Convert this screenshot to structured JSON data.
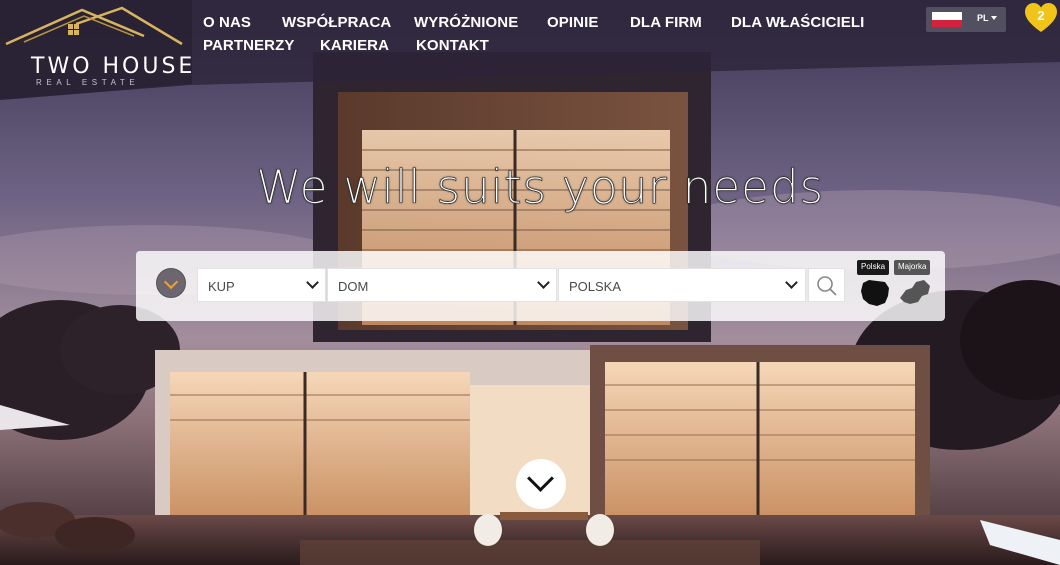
{
  "brand": {
    "name": "TWO HOUSE",
    "tagline": "REAL ESTATE"
  },
  "nav": {
    "items": [
      {
        "label": "O NAS"
      },
      {
        "label": "WSPÓŁPRACA"
      },
      {
        "label": "WYRÓŻNIONE"
      },
      {
        "label": "OPINIE"
      },
      {
        "label": "DLA FIRM"
      },
      {
        "label": "DLA WŁAŚCICIELI"
      },
      {
        "label": "PARTNERZY"
      },
      {
        "label": "KARIERA"
      },
      {
        "label": "KONTAKT"
      }
    ]
  },
  "language": {
    "selected": "PL",
    "flag": "poland-flag-icon"
  },
  "favorites": {
    "count": "2",
    "icon": "heart-icon",
    "color": "#f0c419"
  },
  "hero": {
    "headline": "We will suits your needs"
  },
  "search": {
    "toggle_icon": "chevron-down-icon",
    "toggle_color": "#f3a12a",
    "transaction": {
      "selected": "KUP"
    },
    "property_type": {
      "selected": "DOM"
    },
    "location": {
      "selected": "POLSKA"
    },
    "submit_icon": "search-icon",
    "regions": [
      {
        "label": "Polska",
        "icon": "poland-map-icon"
      },
      {
        "label": "Majorka",
        "icon": "majorca-map-icon"
      }
    ]
  },
  "scroll_icon": "chevron-down-icon"
}
